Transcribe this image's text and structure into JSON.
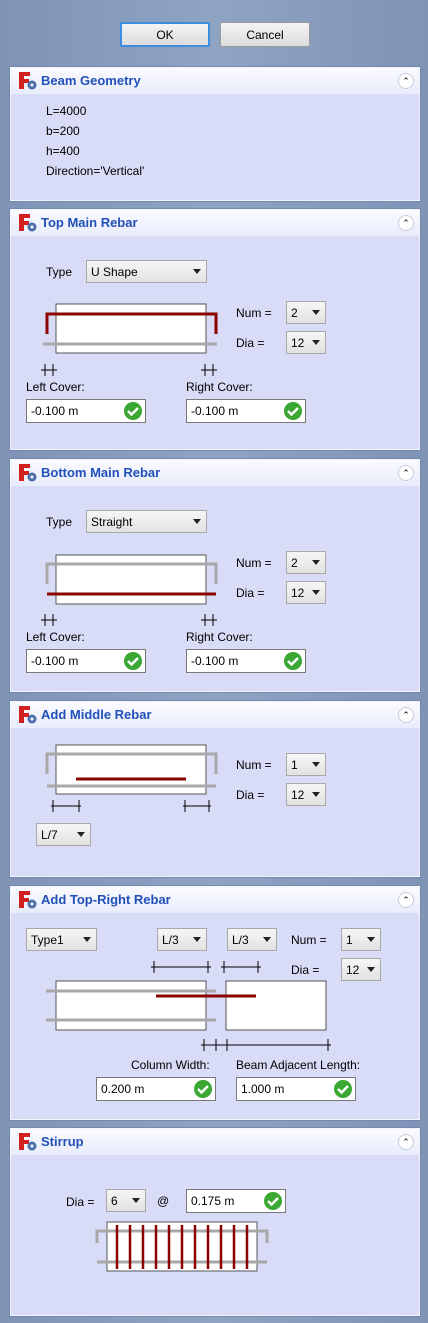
{
  "buttons": {
    "ok": "OK",
    "cancel": "Cancel"
  },
  "panels": {
    "beam_geometry": {
      "title": "Beam Geometry",
      "lines": [
        "L=4000",
        "b=200",
        "h=400",
        "Direction='Vertical'"
      ]
    },
    "top_main": {
      "title": "Top Main Rebar",
      "type_label": "Type",
      "type_value": "U Shape",
      "num_label": "Num =",
      "num_value": "2",
      "dia_label": "Dia =",
      "dia_value": "12",
      "left_cover_label": "Left Cover:",
      "left_cover_value": "-0.100 m",
      "right_cover_label": "Right Cover:",
      "right_cover_value": "-0.100 m"
    },
    "bottom_main": {
      "title": "Bottom Main Rebar",
      "type_label": "Type",
      "type_value": "Straight",
      "num_label": "Num =",
      "num_value": "2",
      "dia_label": "Dia =",
      "dia_value": "12",
      "left_cover_label": "Left Cover:",
      "left_cover_value": "-0.100 m",
      "right_cover_label": "Right Cover:",
      "right_cover_value": "-0.100 m"
    },
    "middle": {
      "title": "Add Middle Rebar",
      "num_label": "Num =",
      "num_value": "1",
      "dia_label": "Dia =",
      "dia_value": "12",
      "length_value": "L/7"
    },
    "top_right": {
      "title": "Add Top-Right Rebar",
      "type_value": "Type1",
      "len1_value": "L/3",
      "len2_value": "L/3",
      "num_label": "Num =",
      "num_value": "1",
      "dia_label": "Dia =",
      "dia_value": "12",
      "col_width_label": "Column Width:",
      "col_width_value": "0.200 m",
      "adj_len_label": "Beam Adjacent Length:",
      "adj_len_value": "1.000 m"
    },
    "stirrup": {
      "title": "Stirrup",
      "dia_label": "Dia =",
      "dia_value": "6",
      "at_label": "@",
      "spacing_value": "0.175 m",
      "count": 11
    }
  },
  "colors": {
    "rebar_active": "#8b0000",
    "rebar_inactive": "#a8a8a8",
    "title": "#2050b8",
    "panel_bg": "#d8dcf6",
    "check": "#3aa832"
  },
  "icons": {
    "logo": "freecad-logo-icon",
    "collapse": "double-chevron-up-icon",
    "valid": "checkmark-icon"
  }
}
